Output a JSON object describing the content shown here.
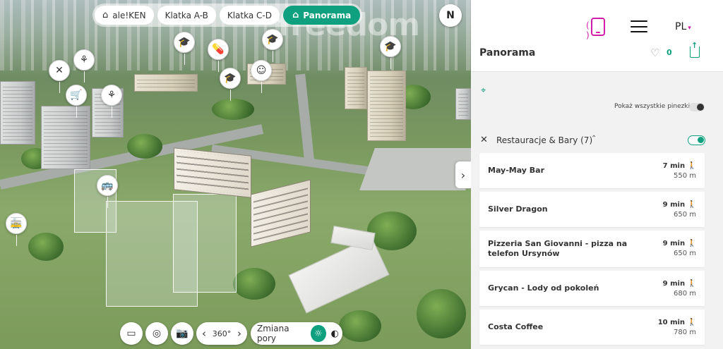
{
  "colors": {
    "accent": "#0ea07f",
    "brand_magenta": "#d21ca8"
  },
  "watermark": "freedom",
  "scene_tabs": [
    {
      "label": "ale!KEN",
      "icon": "building-icon",
      "active": false
    },
    {
      "label": "Klatka A-B",
      "active": false
    },
    {
      "label": "Klatka C-D",
      "active": false
    },
    {
      "label": "Panorama",
      "icon": "panorama-icon",
      "active": true
    }
  ],
  "compass": {
    "label": "N"
  },
  "toolbar": {
    "rotation_label": "360°",
    "time_of_day_label": "Zmiana pory"
  },
  "panel": {
    "language": "PL",
    "title": "Panorama",
    "likes": "0",
    "show_all_pins_label": "Pokaż wszystkie pinezki",
    "category": {
      "label": "Restauracje & Bary (7)",
      "enabled": true
    },
    "places": [
      {
        "name": "May-May Bar",
        "time": "7 min",
        "distance": "550 m"
      },
      {
        "name": "Silver Dragon",
        "time": "9 min",
        "distance": "650 m"
      },
      {
        "name": "Pizzeria San Giovanni - pizza na telefon Ursynów",
        "time": "9 min",
        "distance": "650 m"
      },
      {
        "name": "Grycan - Lody od pokoleń",
        "time": "9 min",
        "distance": "680 m"
      },
      {
        "name": "Costa Coffee",
        "time": "10 min",
        "distance": "780 m"
      }
    ]
  }
}
